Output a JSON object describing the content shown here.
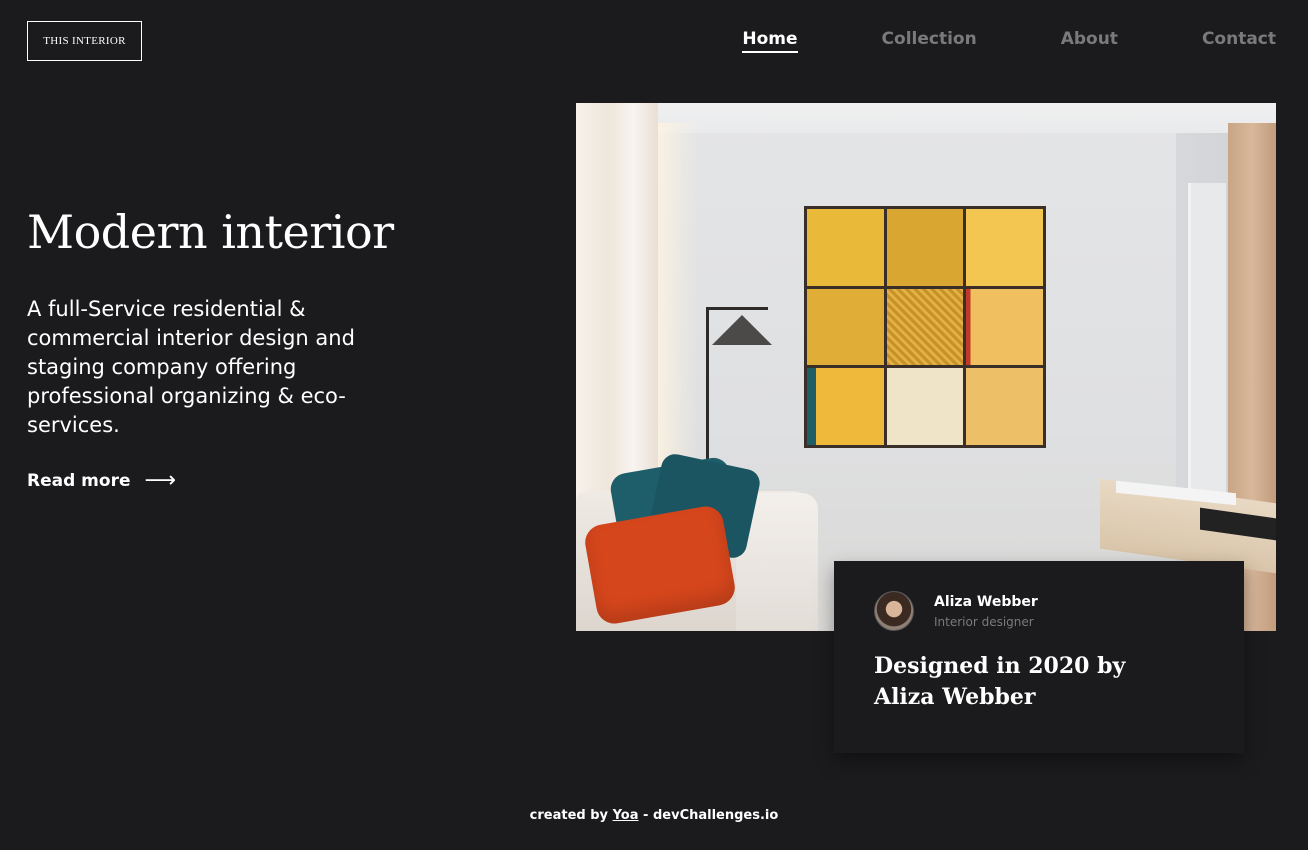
{
  "logo": {
    "text": "THIS INTERIOR"
  },
  "nav": {
    "items": [
      {
        "label": "Home",
        "active": true
      },
      {
        "label": "Collection",
        "active": false
      },
      {
        "label": "About",
        "active": false
      },
      {
        "label": "Contact",
        "active": false
      }
    ]
  },
  "hero": {
    "title": "Modern interior",
    "description": "A full-Service residential & commercial interior design and staging company offering professional organizing & eco-services.",
    "read_more": "Read more",
    "arrow": "⟶"
  },
  "card": {
    "name": "Aliza Webber",
    "role": "Interior designer",
    "title": "Designed in 2020 by Aliza Webber"
  },
  "footer": {
    "prefix": "created by",
    "author": "Yoa",
    "separator": "-",
    "site": "devChallenges.io"
  },
  "colors": {
    "background": "#1b1a1c",
    "text": "#ffffff",
    "muted": "#7a797c"
  }
}
